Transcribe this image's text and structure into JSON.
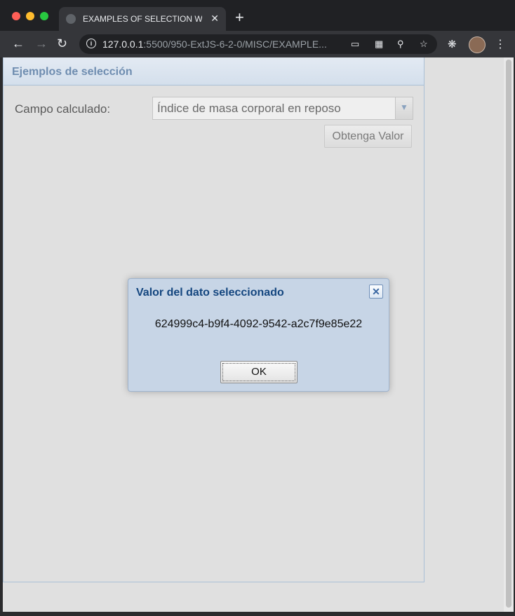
{
  "browser": {
    "tab_title": "EXAMPLES OF SELECTION WI",
    "tab_close": "✕",
    "new_tab": "+",
    "url_host": "127.0.0.1",
    "url_path": ":5500/950-ExtJS-6-2-0/MISC/EXAMPLE..."
  },
  "panel": {
    "title": "Ejemplos de selección",
    "field_label": "Campo calculado:",
    "combo_value": "Índice de masa corporal en reposo",
    "button_label": "Obtenga Valor"
  },
  "dialog": {
    "title": "Valor del dato seleccionado",
    "close_glyph": "✕",
    "message": "624999c4-b9f4-4092-9542-a2c7f9e85e22",
    "ok_label": "OK"
  },
  "colors": {
    "dialog_bg": "#c7d5e6",
    "dialog_title": "#14467f",
    "panel_title": "#6f8db0"
  }
}
